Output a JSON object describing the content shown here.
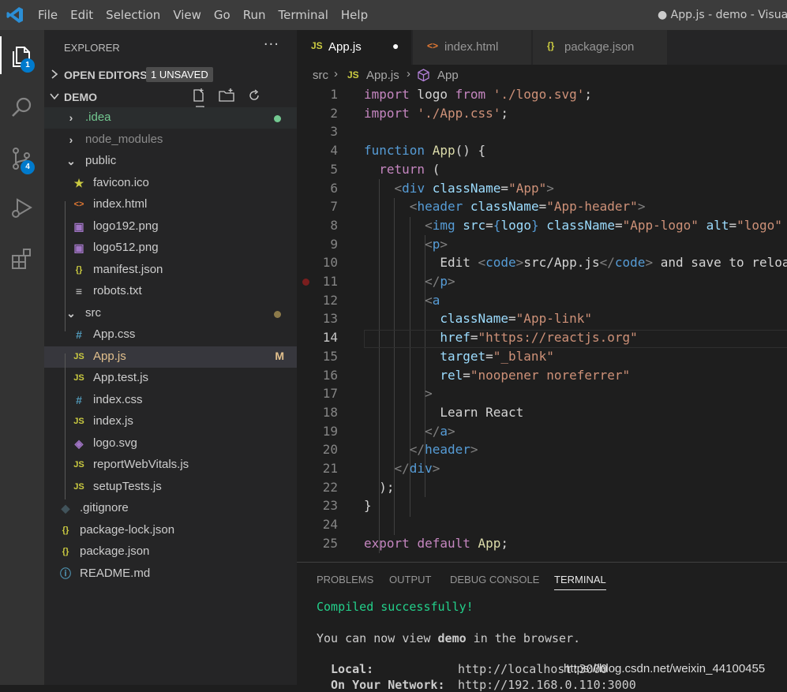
{
  "window": {
    "menu": [
      "File",
      "Edit",
      "Selection",
      "View",
      "Go",
      "Run",
      "Terminal",
      "Help"
    ],
    "title": "● App.js - demo - Visual"
  },
  "activity_bar": {
    "explorer_badge": "1",
    "source_control_badge": "4"
  },
  "explorer": {
    "header": "EXPLORER",
    "more": "···",
    "open_editors": "OPEN EDITORS",
    "unsaved_badge": "1 UNSAVED",
    "folder": "DEMO",
    "items": [
      {
        "name": ".idea",
        "icon": "›",
        "status": ""
      },
      {
        "name": "node_modules",
        "icon": "›",
        "status": ""
      },
      {
        "name": "public",
        "icon": "⌄",
        "status": ""
      },
      {
        "name": "favicon.ico",
        "icon": "★",
        "status": ""
      },
      {
        "name": "index.html",
        "icon": "<>",
        "status": ""
      },
      {
        "name": "logo192.png",
        "icon": "▣",
        "status": ""
      },
      {
        "name": "logo512.png",
        "icon": "▣",
        "status": ""
      },
      {
        "name": "manifest.json",
        "icon": "{}",
        "status": ""
      },
      {
        "name": "robots.txt",
        "icon": "≡",
        "status": ""
      },
      {
        "name": "src",
        "icon": "⌄",
        "status": ""
      },
      {
        "name": "App.css",
        "icon": "#",
        "status": ""
      },
      {
        "name": "App.js",
        "icon": "JS",
        "status": "M"
      },
      {
        "name": "App.test.js",
        "icon": "JS",
        "status": ""
      },
      {
        "name": "index.css",
        "icon": "#",
        "status": ""
      },
      {
        "name": "index.js",
        "icon": "JS",
        "status": ""
      },
      {
        "name": "logo.svg",
        "icon": "◈",
        "status": ""
      },
      {
        "name": "reportWebVitals.js",
        "icon": "JS",
        "status": ""
      },
      {
        "name": "setupTests.js",
        "icon": "JS",
        "status": ""
      },
      {
        "name": ".gitignore",
        "icon": "◆",
        "status": ""
      },
      {
        "name": "package-lock.json",
        "icon": "{}",
        "status": ""
      },
      {
        "name": "package.json",
        "icon": "{}",
        "status": ""
      },
      {
        "name": "README.md",
        "icon": "ⓘ",
        "status": ""
      }
    ]
  },
  "tabs": [
    {
      "label": "App.js",
      "icon": "JS",
      "dirty": "●"
    },
    {
      "label": "index.html",
      "icon": "<>"
    },
    {
      "label": "package.json",
      "icon": "{}"
    }
  ],
  "breadcrumb": {
    "root": "src",
    "sep": "›",
    "file": "App.js",
    "symbol": "App"
  },
  "code_lines": [
    {
      "n": "1",
      "t": [
        [
          "kw2",
          "import"
        ],
        [
          "txt",
          " logo "
        ],
        [
          "kw2",
          "from"
        ],
        [
          "txt",
          " "
        ],
        [
          "str",
          "'./logo.svg'"
        ],
        [
          "txt",
          ";"
        ]
      ]
    },
    {
      "n": "2",
      "t": [
        [
          "kw2",
          "import"
        ],
        [
          "txt",
          " "
        ],
        [
          "str",
          "'./App.css'"
        ],
        [
          "txt",
          ";"
        ]
      ]
    },
    {
      "n": "3",
      "t": []
    },
    {
      "n": "4",
      "t": [
        [
          "kw",
          "function"
        ],
        [
          "txt",
          " "
        ],
        [
          "fn",
          "App"
        ],
        [
          "txt",
          "() {"
        ]
      ]
    },
    {
      "n": "5",
      "t": [
        [
          "txt",
          "  "
        ],
        [
          "ctrl",
          "return"
        ],
        [
          "txt",
          " ("
        ]
      ]
    },
    {
      "n": "6",
      "t": [
        [
          "txt",
          "    "
        ],
        [
          "pun",
          "<"
        ],
        [
          "tag",
          "div"
        ],
        [
          "txt",
          " "
        ],
        [
          "attr",
          "className"
        ],
        [
          "txt",
          "="
        ],
        [
          "str",
          "\"App\""
        ],
        [
          "pun",
          ">"
        ]
      ]
    },
    {
      "n": "7",
      "t": [
        [
          "txt",
          "      "
        ],
        [
          "pun",
          "<"
        ],
        [
          "tag",
          "header"
        ],
        [
          "txt",
          " "
        ],
        [
          "attr",
          "className"
        ],
        [
          "txt",
          "="
        ],
        [
          "str",
          "\"App-header\""
        ],
        [
          "pun",
          ">"
        ]
      ]
    },
    {
      "n": "8",
      "t": [
        [
          "txt",
          "        "
        ],
        [
          "pun",
          "<"
        ],
        [
          "tag",
          "img"
        ],
        [
          "txt",
          " "
        ],
        [
          "attr",
          "src"
        ],
        [
          "txt",
          "="
        ],
        [
          "kw",
          "{"
        ],
        [
          "var",
          "logo"
        ],
        [
          "kw",
          "}"
        ],
        [
          "txt",
          " "
        ],
        [
          "attr",
          "className"
        ],
        [
          "txt",
          "="
        ],
        [
          "str",
          "\"App-logo\""
        ],
        [
          "txt",
          " "
        ],
        [
          "attr",
          "alt"
        ],
        [
          "txt",
          "="
        ],
        [
          "str",
          "\"logo\""
        ]
      ]
    },
    {
      "n": "9",
      "t": [
        [
          "txt",
          "        "
        ],
        [
          "pun",
          "<"
        ],
        [
          "tag",
          "p"
        ],
        [
          "pun",
          ">"
        ]
      ]
    },
    {
      "n": "10",
      "t": [
        [
          "txt",
          "          Edit "
        ],
        [
          "pun",
          "<"
        ],
        [
          "tag",
          "code"
        ],
        [
          "pun",
          ">"
        ],
        [
          "txt",
          "src/App.js"
        ],
        [
          "pun",
          "</"
        ],
        [
          "tag",
          "code"
        ],
        [
          "pun",
          ">"
        ],
        [
          "txt",
          " and save to reloa"
        ]
      ]
    },
    {
      "n": "11",
      "t": [
        [
          "txt",
          "        "
        ],
        [
          "pun",
          "</"
        ],
        [
          "tag",
          "p"
        ],
        [
          "pun",
          ">"
        ]
      ]
    },
    {
      "n": "12",
      "t": [
        [
          "txt",
          "        "
        ],
        [
          "pun",
          "<"
        ],
        [
          "tag",
          "a"
        ]
      ]
    },
    {
      "n": "13",
      "t": [
        [
          "txt",
          "          "
        ],
        [
          "attr",
          "className"
        ],
        [
          "txt",
          "="
        ],
        [
          "str",
          "\"App-link\""
        ]
      ]
    },
    {
      "n": "14",
      "t": [
        [
          "txt",
          "          "
        ],
        [
          "attr",
          "href"
        ],
        [
          "txt",
          "="
        ],
        [
          "str",
          "\"https://reactjs.org\""
        ]
      ]
    },
    {
      "n": "15",
      "t": [
        [
          "txt",
          "          "
        ],
        [
          "attr",
          "target"
        ],
        [
          "txt",
          "="
        ],
        [
          "str",
          "\"_blank\""
        ]
      ]
    },
    {
      "n": "16",
      "t": [
        [
          "txt",
          "          "
        ],
        [
          "attr",
          "rel"
        ],
        [
          "txt",
          "="
        ],
        [
          "str",
          "\"noopener noreferrer\""
        ]
      ]
    },
    {
      "n": "17",
      "t": [
        [
          "txt",
          "        "
        ],
        [
          "pun",
          ">"
        ]
      ]
    },
    {
      "n": "18",
      "t": [
        [
          "txt",
          "          Learn React"
        ]
      ]
    },
    {
      "n": "19",
      "t": [
        [
          "txt",
          "        "
        ],
        [
          "pun",
          "</"
        ],
        [
          "tag",
          "a"
        ],
        [
          "pun",
          ">"
        ]
      ]
    },
    {
      "n": "20",
      "t": [
        [
          "txt",
          "      "
        ],
        [
          "pun",
          "</"
        ],
        [
          "tag",
          "header"
        ],
        [
          "pun",
          ">"
        ]
      ]
    },
    {
      "n": "21",
      "t": [
        [
          "txt",
          "    "
        ],
        [
          "pun",
          "</"
        ],
        [
          "tag",
          "div"
        ],
        [
          "pun",
          ">"
        ]
      ]
    },
    {
      "n": "22",
      "t": [
        [
          "txt",
          "  );"
        ]
      ]
    },
    {
      "n": "23",
      "t": [
        [
          "txt",
          "}"
        ]
      ]
    },
    {
      "n": "24",
      "t": []
    },
    {
      "n": "25",
      "t": [
        [
          "kw2",
          "export"
        ],
        [
          "txt",
          " "
        ],
        [
          "kw2",
          "default"
        ],
        [
          "txt",
          " "
        ],
        [
          "fn",
          "App"
        ],
        [
          "txt",
          ";"
        ]
      ]
    }
  ],
  "panel": {
    "tabs": [
      "PROBLEMS",
      "OUTPUT",
      "DEBUG CONSOLE",
      "TERMINAL"
    ],
    "compiled": "Compiled successfully!",
    "view_prefix": "You can now view ",
    "view_app": "demo",
    "view_suffix": " in the browser.",
    "local_label": "Local:",
    "local_url": "http://localhost:3000",
    "network_label": "On Your Network:",
    "network_url": "http://192.168.0.110:3000"
  },
  "watermark": "https://blog.csdn.net/weixin_44100455",
  "colors": {
    "accent": "#007acc",
    "modified": "#e2c08d",
    "success": "#23d18b",
    "js_icon": "#cbcb41"
  }
}
